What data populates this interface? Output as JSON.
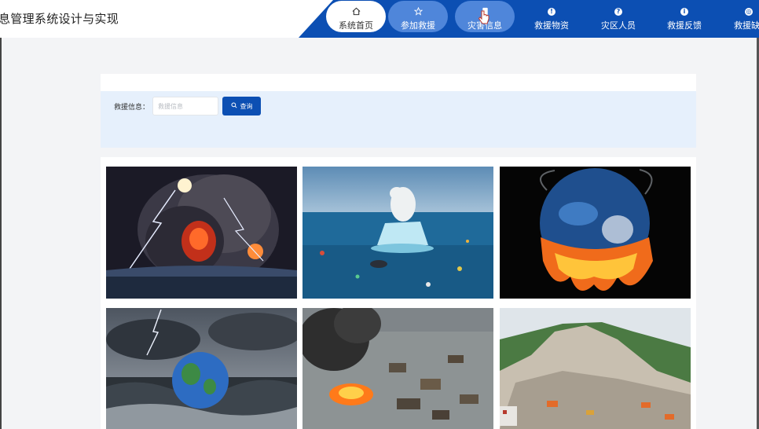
{
  "header": {
    "app_title": "息管理系统设计与实现",
    "nav": [
      {
        "label": "系统首页",
        "icon": "home-icon",
        "active": true
      },
      {
        "label": "参加救援",
        "icon": "star-icon"
      },
      {
        "label": "灾害信息",
        "icon": "document-icon",
        "hovered": true
      },
      {
        "label": "救援物资",
        "icon": "info-dot-icon"
      },
      {
        "label": "灾区人员",
        "icon": "help-dot-icon"
      },
      {
        "label": "救援反馈",
        "icon": "info-dot-icon"
      },
      {
        "label": "救援缺",
        "icon": "gear-icon"
      }
    ]
  },
  "search": {
    "label": "救援信息：",
    "placeholder": "救援信息",
    "value": "",
    "button_label": "查询"
  },
  "gallery": {
    "items": [
      {
        "name": "volcano-lightning-image"
      },
      {
        "name": "polar-bear-iceberg-image"
      },
      {
        "name": "melting-earth-image"
      },
      {
        "name": "earth-storm-sea-image"
      },
      {
        "name": "burning-flood-image"
      },
      {
        "name": "landslide-image"
      }
    ]
  },
  "colors": {
    "primary": "#0c4fb3",
    "nav_pill": "#4f86da",
    "search_bg": "#e6f0fc",
    "page_bg": "#f3f4f6"
  }
}
